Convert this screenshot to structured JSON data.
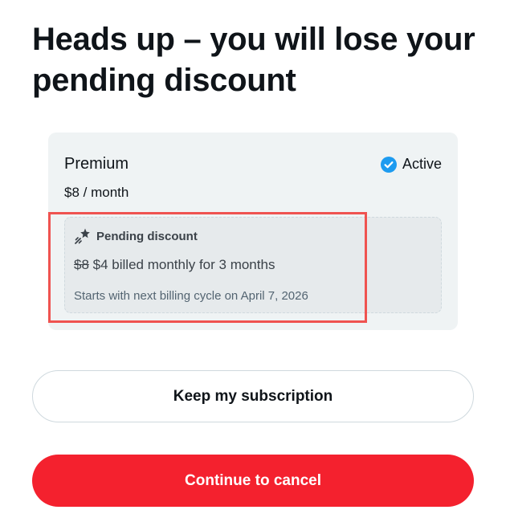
{
  "dialog": {
    "title": "Heads up – you will lose your pending discount"
  },
  "plan": {
    "name": "Premium",
    "price": "$8 / month",
    "status_label": "Active",
    "status_icon": "check-badge-icon",
    "status_color": "#1d9bf0"
  },
  "discount": {
    "icon": "sparkle-icon",
    "title": "Pending discount",
    "old_price": "$8",
    "new_price_text": "$4 billed monthly for 3 months",
    "note": "Starts with next billing cycle on April 7, 2026"
  },
  "actions": {
    "keep_label": "Keep my subscription",
    "cancel_label": "Continue to cancel",
    "cancel_color": "#f4212e"
  },
  "annotation": {
    "highlight_color": "#ef5350"
  }
}
